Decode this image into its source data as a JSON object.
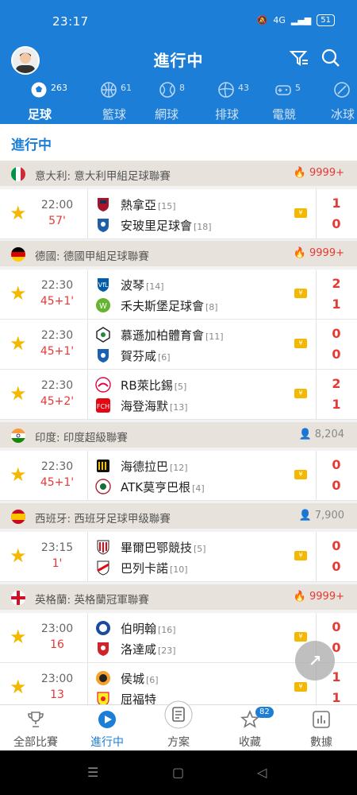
{
  "status_bar": {
    "time": "23:17",
    "battery": "51",
    "network": "4G"
  },
  "header": {
    "title": "進行中"
  },
  "tabs": [
    {
      "label": "足球",
      "count": "263",
      "icon": "soccer-ball-icon",
      "active": true
    },
    {
      "label": "籃球",
      "count": "61",
      "icon": "basketball-icon"
    },
    {
      "label": "網球",
      "count": "8",
      "icon": "tennis-ball-icon"
    },
    {
      "label": "排球",
      "count": "43",
      "icon": "volleyball-icon"
    },
    {
      "label": "電競",
      "count": "5",
      "icon": "gamepad-icon"
    },
    {
      "label": "冰球",
      "count": "",
      "icon": "hockey-icon"
    }
  ],
  "section": {
    "title": "進行中"
  },
  "leagues": [
    {
      "name": "意大利: 意大利甲組足球聯賽",
      "hot": "9999+",
      "flag": "italy",
      "matches": [
        {
          "time": "22:00",
          "minute": "57'",
          "home": "熱拿亞",
          "home_rank": "[15]",
          "away": "安玻里足球會",
          "away_rank": "[18]",
          "home_score": "1",
          "away_score": "0"
        }
      ]
    },
    {
      "name": "德國: 德國甲組足球聯賽",
      "hot": "9999+",
      "flag": "germany",
      "matches": [
        {
          "time": "22:30",
          "minute": "45+1'",
          "home": "波琴",
          "home_rank": "[14]",
          "away": "禾夫斯堡足球會",
          "away_rank": "[8]",
          "home_score": "2",
          "away_score": "1"
        },
        {
          "time": "22:30",
          "minute": "45+1'",
          "home": "慕遜加柏體育會",
          "home_rank": "[11]",
          "away": "賀芬咸",
          "away_rank": "[6]",
          "home_score": "0",
          "away_score": "0"
        },
        {
          "time": "22:30",
          "minute": "45+2'",
          "home": "RB萊比錫",
          "home_rank": "[5]",
          "away": "海登海默",
          "away_rank": "[13]",
          "home_score": "2",
          "away_score": "1"
        }
      ]
    },
    {
      "name": "印度: 印度超級聯賽",
      "fans": "8,204",
      "flag": "india",
      "matches": [
        {
          "time": "22:30",
          "minute": "45+1'",
          "home": "海德拉巴",
          "home_rank": "[12]",
          "away": "ATK莫亨巴根",
          "away_rank": "[4]",
          "home_score": "0",
          "away_score": "0"
        }
      ]
    },
    {
      "name": "西班牙: 西班牙足球甲级聯賽",
      "fans": "7,900",
      "flag": "spain",
      "matches": [
        {
          "time": "23:15",
          "minute": "1'",
          "home": "畢爾巴鄂競技",
          "home_rank": "[5]",
          "away": "巴列卡諾",
          "away_rank": "[10]",
          "home_score": "0",
          "away_score": "0"
        }
      ]
    },
    {
      "name": "英格蘭: 英格蘭冠軍聯賽",
      "hot": "9999+",
      "flag": "england",
      "matches": [
        {
          "time": "23:00",
          "minute": "16",
          "home": "伯明翰",
          "home_rank": "[16]",
          "away": "洛達咸",
          "away_rank": "[23]",
          "home_score": "0",
          "away_score": "0"
        },
        {
          "time": "23:00",
          "minute": "13",
          "home": "侯城",
          "home_rank": "[6]",
          "away": "屈福特",
          "away_rank": "",
          "home_score": "1",
          "away_score": "1"
        }
      ]
    }
  ],
  "bottom_nav": [
    {
      "label": "全部比賽",
      "icon": "trophy-icon"
    },
    {
      "label": "進行中",
      "icon": "play-icon",
      "active": true
    },
    {
      "label": "方案",
      "icon": "document-icon"
    },
    {
      "label": "收藏",
      "icon": "star-icon",
      "badge": "82"
    },
    {
      "label": "數據",
      "icon": "bar-chart-icon"
    }
  ],
  "colors": {
    "primary": "#1c7ed6",
    "score": "#e53935",
    "star": "#f5b800"
  }
}
